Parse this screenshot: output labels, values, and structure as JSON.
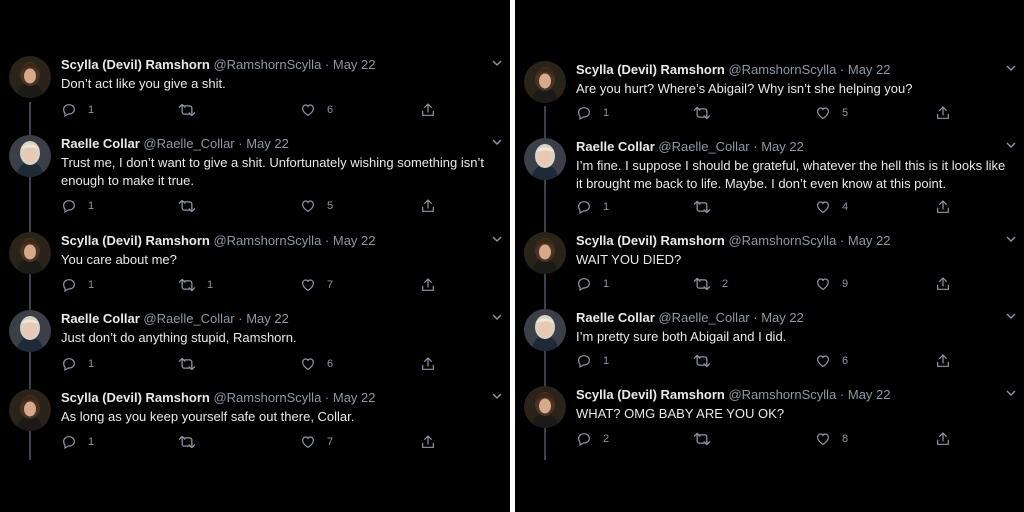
{
  "panels": [
    {
      "tweets": [
        {
          "author": "scylla",
          "display_name": "Scylla (Devil) Ramshorn",
          "handle": "@RamshornScylla",
          "date": "May 22",
          "text": "Don’t act like you give a shit.",
          "replies": "1",
          "retweets": "",
          "likes": "6"
        },
        {
          "author": "raelle",
          "display_name": "Raelle Collar",
          "handle": "@Raelle_Collar",
          "date": "May 22",
          "text": "Trust me, I don’t want to give a shit. Unfortunately wishing something isn’t enough to make it true.",
          "replies": "1",
          "retweets": "",
          "likes": "5"
        },
        {
          "author": "scylla",
          "display_name": "Scylla (Devil) Ramshorn",
          "handle": "@RamshornScylla",
          "date": "May 22",
          "text": "You care about me?",
          "replies": "1",
          "retweets": "1",
          "likes": "7"
        },
        {
          "author": "raelle",
          "display_name": "Raelle Collar",
          "handle": "@Raelle_Collar",
          "date": "May 22",
          "text": "Just don’t do anything stupid, Ramshorn.",
          "replies": "1",
          "retweets": "",
          "likes": "6"
        },
        {
          "author": "scylla",
          "display_name": "Scylla (Devil) Ramshorn",
          "handle": "@RamshornScylla",
          "date": "May 22",
          "text": "As long as you keep yourself safe out there, Collar.",
          "replies": "1",
          "retweets": "",
          "likes": "7"
        }
      ]
    },
    {
      "tweets": [
        {
          "author": "scylla",
          "display_name": "Scylla (Devil) Ramshorn",
          "handle": "@RamshornScylla",
          "date": "May 22",
          "text": "Are you hurt? Where’s Abigail? Why isn’t she helping you?",
          "replies": "1",
          "retweets": "",
          "likes": "5"
        },
        {
          "author": "raelle",
          "display_name": "Raelle Collar",
          "handle": "@Raelle_Collar",
          "date": "May 22",
          "text": "I’m fine. I suppose I should be grateful, whatever the hell this is it looks like it brought me back to life. Maybe. I don’t even know at this point.",
          "replies": "1",
          "retweets": "",
          "likes": "4"
        },
        {
          "author": "scylla",
          "display_name": "Scylla (Devil) Ramshorn",
          "handle": "@RamshornScylla",
          "date": "May 22",
          "text": "WAIT YOU DIED?",
          "replies": "1",
          "retweets": "2",
          "likes": "9"
        },
        {
          "author": "raelle",
          "display_name": "Raelle Collar",
          "handle": "@Raelle_Collar",
          "date": "May 22",
          "text": "I’m pretty sure both Abigail and I did.",
          "replies": "1",
          "retweets": "",
          "likes": "6"
        },
        {
          "author": "scylla",
          "display_name": "Scylla (Devil) Ramshorn",
          "handle": "@RamshornScylla",
          "date": "May 22",
          "text": "WHAT? OMG BABY ARE YOU OK?",
          "replies": "2",
          "retweets": "",
          "likes": "8"
        }
      ]
    }
  ],
  "colors": {
    "background": "#000000",
    "text_primary": "#e7e9ea",
    "text_secondary": "#8b98a5",
    "thread_line": "#38444d",
    "divider": "#ffffff"
  },
  "icons": {
    "reply": "reply-icon",
    "retweet": "retweet-icon",
    "like": "like-icon",
    "share": "share-icon",
    "more": "chevron-down-icon"
  }
}
